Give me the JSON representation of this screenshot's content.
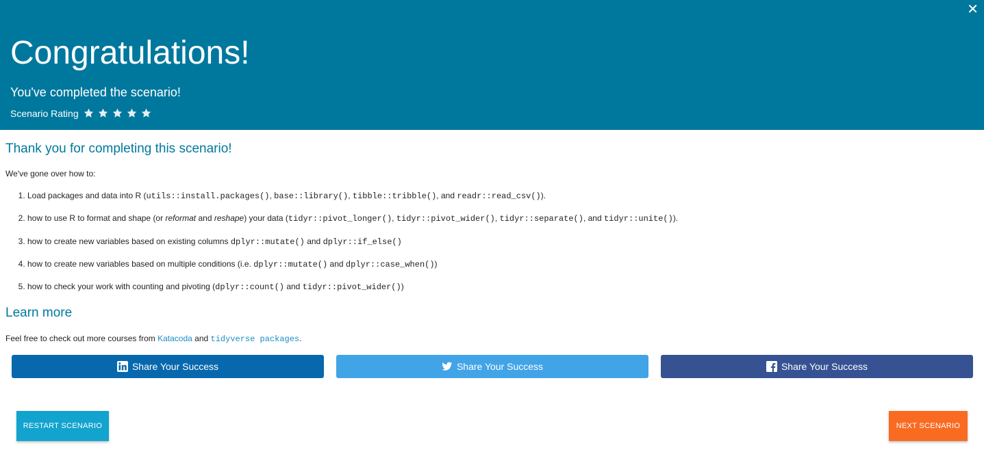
{
  "header": {
    "close_glyph": "✕",
    "title": "Congratulations!",
    "subtitle": "You've completed the scenario!",
    "rating_label": "Scenario Rating",
    "rating_star_count": 5
  },
  "content": {
    "thanks_heading": "Thank you for completing this scenario!",
    "intro": "We've gone over how to:",
    "steps": [
      {
        "parts": [
          {
            "t": "text",
            "v": "Load packages and data into R ("
          },
          {
            "t": "code",
            "v": "utils::install.packages()"
          },
          {
            "t": "text",
            "v": ", "
          },
          {
            "t": "code",
            "v": "base::library()"
          },
          {
            "t": "text",
            "v": ", "
          },
          {
            "t": "code",
            "v": "tibble::tribble()"
          },
          {
            "t": "text",
            "v": ", and "
          },
          {
            "t": "code",
            "v": "readr::read_csv()"
          },
          {
            "t": "text",
            "v": ")."
          }
        ]
      },
      {
        "parts": [
          {
            "t": "text",
            "v": "how to use R to format and shape (or "
          },
          {
            "t": "em",
            "v": "reformat"
          },
          {
            "t": "text",
            "v": " and "
          },
          {
            "t": "em",
            "v": "reshape"
          },
          {
            "t": "text",
            "v": ") your data ("
          },
          {
            "t": "code",
            "v": "tidyr::pivot_longer()"
          },
          {
            "t": "text",
            "v": ", "
          },
          {
            "t": "code",
            "v": "tidyr::pivot_wider()"
          },
          {
            "t": "text",
            "v": ", "
          },
          {
            "t": "code",
            "v": "tidyr::separate()"
          },
          {
            "t": "text",
            "v": ", and "
          },
          {
            "t": "code",
            "v": "tidyr::unite()"
          },
          {
            "t": "text",
            "v": ")."
          }
        ]
      },
      {
        "parts": [
          {
            "t": "text",
            "v": "how to create new variables based on existing columns "
          },
          {
            "t": "code",
            "v": "dplyr::mutate()"
          },
          {
            "t": "text",
            "v": " and "
          },
          {
            "t": "code",
            "v": "dplyr::if_else()"
          }
        ]
      },
      {
        "parts": [
          {
            "t": "text",
            "v": "how to create new variables based on multiple conditions (i.e. "
          },
          {
            "t": "code",
            "v": "dplyr::mutate()"
          },
          {
            "t": "text",
            "v": " and "
          },
          {
            "t": "code",
            "v": "dplyr::case_when()"
          },
          {
            "t": "text",
            "v": ")"
          }
        ]
      },
      {
        "parts": [
          {
            "t": "text",
            "v": "how to check your work with counting and pivoting ("
          },
          {
            "t": "code",
            "v": "dplyr::count()"
          },
          {
            "t": "text",
            "v": " and "
          },
          {
            "t": "code",
            "v": "tidyr::pivot_wider()"
          },
          {
            "t": "text",
            "v": ")"
          }
        ]
      }
    ],
    "learn_heading": "Learn more",
    "feel_prefix": "Feel free to check out more courses from ",
    "katacoda_link": "Katacoda",
    "feel_and": " and ",
    "tidyverse_link": "tidyverse packages",
    "feel_suffix": "."
  },
  "share": {
    "linkedin_label": "Share Your Success",
    "twitter_label": "Share Your Success",
    "facebook_label": "Share Your Success",
    "colors": {
      "linkedin": "#0868ad",
      "twitter": "#41a4e6",
      "facebook": "#365292"
    }
  },
  "actions": {
    "restart_label": "RESTART SCENARIO",
    "next_label": "NEXT SCENARIO"
  },
  "colors": {
    "header_bg": "#00789e",
    "heading_teal": "#00789e",
    "link_blue": "#1a8cc8",
    "restart_bg": "#12a3cf",
    "next_bg": "#fa6b22"
  }
}
